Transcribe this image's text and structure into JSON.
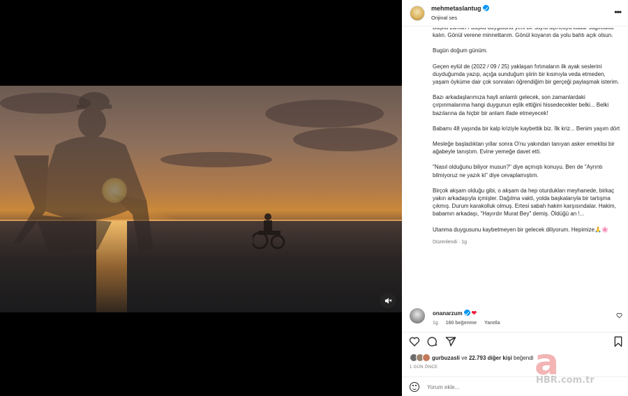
{
  "post": {
    "username": "mehmetaslantug",
    "audio": "Orijinal ses",
    "caption_top_cut": "Başka zaman / başka duygularla yeni bir sayfa açıncaya kadar sağlıcakla kalın. Gönül verene minnettarım. Gönül koyanın da yolu bahtı açık olsun.",
    "caption_paragraphs": [
      "Bugün doğum günüm.",
      "Geçen eylül de (2022 / 09 / 25) yaklaşan fırtınaların ilk ayak seslerini duyduğumda yazıp, açığa sunduğum şiirin bir kısmıyla veda etmeden, yaşam öyküme dair çok sonraları öğrendiğim bir gerçeği paylaşmak isterim.",
      "Bazı arkadaşlarımıza hayli anlamlı gelecek, son zamanlardaki çırpınmalarıma hangi duygunun eşlik ettiğini hissedecekler belki... Belki bazılarına da hiçbir bir anlam ifade etmeyecek!",
      "Babamı 48 yaşında bir kalp kriziyle kaybettik biz. İlk kriz... Benim yaşım dört",
      "Mesleğe başladıktan yıllar sonra O'nu yakından tanıyan asker emeklisi bir ağabeyle tanıştım. Evine yemeğe davet etti.",
      "\"Nasıl olduğunu biliyor musun?\" diye açmıştı konuyu. Ben de \"Ayrıntı bilmiyoruz ne yazık ki\" diye cevaplamıştım.",
      "Birçok akşam olduğu gibi, o akşam da hep oturdukları meyhanede, birkaç yakın arkadaşıyla içmişler. Dağılma vakti, yolda başkalarıyla bir tartışma çıkmış. Durum karakolluk olmuş. Ertesi sabah hakim karşısındalar. Hakim, babamın arkadaşı, \"Hayırdır Murat Bey\" demiş. Öldüğü an !...",
      "Utanma duygusunu kaybetmeyen bir gelecek diliyorum. Hepimize🙏🌸"
    ],
    "edited_label": "Düzenlendi",
    "edited_time": "1g"
  },
  "comment": {
    "username": "onanarzum",
    "text_emoji": "❤",
    "time": "1g",
    "likes": "160 beğenme",
    "reply": "Yanıtla"
  },
  "likes": {
    "user": "gurbuzasli",
    "connector": "ve",
    "count": "22.793 diğer kişi",
    "suffix": "beğendi"
  },
  "time_ago": "1 GÜN ÖNCE",
  "add_comment": {
    "placeholder": "Yorum ekle..."
  },
  "watermark": {
    "letter": "a",
    "text": "HBR.com.tr"
  },
  "icons": {
    "more": "more-icon",
    "verified": "verified-badge-icon",
    "like": "heart-icon",
    "comment": "comment-icon",
    "share": "share-icon",
    "save": "bookmark-icon",
    "mute": "mute-icon",
    "emoji": "emoji-icon"
  },
  "colors": {
    "verified": "#0095f6",
    "heart": "#ed1c3a",
    "secondary_text": "#737373"
  }
}
